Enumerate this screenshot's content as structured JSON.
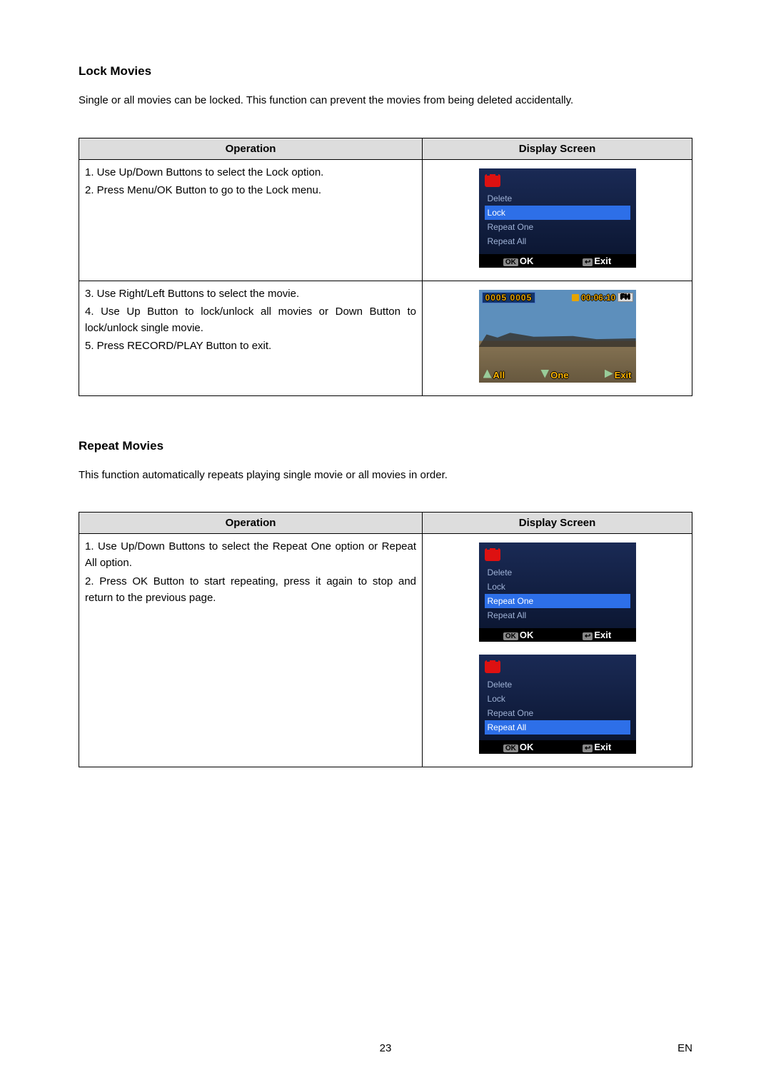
{
  "sections": {
    "lock": {
      "heading": "Lock Movies",
      "lead": "Single or all movies can be locked. This function can prevent the movies from being deleted accidentally.",
      "table": {
        "head_op": "Operation",
        "head_ds": "Display Screen",
        "row1": {
          "steps": [
            "1. Use Up/Down Buttons to select the Lock option.",
            "2. Press Menu/OK Button to go to the Lock menu."
          ],
          "menu": {
            "items": [
              "Delete",
              "Lock",
              "Repeat One",
              "Repeat All"
            ],
            "selected": "Lock",
            "footer_ok": "OK",
            "footer_exit": "Exit",
            "ok_pill": "OK",
            "exit_pill": "↩"
          }
        },
        "row2": {
          "steps": [
            "3. Use Right/Left Buttons to select the movie.",
            "4. Use Up Button to lock/unlock all movies or Down Button to lock/unlock single movie.",
            "5. Press RECORD/PLAY Button to exit."
          ],
          "play": {
            "counter": "0005 0005",
            "time": "00:06:10",
            "badge": "FH",
            "bot_all": "All",
            "bot_one": "One",
            "bot_exit": "Exit"
          }
        }
      }
    },
    "repeat": {
      "heading": "Repeat Movies",
      "lead": "This function automatically repeats playing single movie or all movies in order.",
      "table": {
        "head_op": "Operation",
        "head_ds": "Display Screen",
        "row1": {
          "steps": [
            "1. Use Up/Down Buttons to select the Repeat One option or Repeat All option.",
            "2. Press OK Button to start repeating, press it again to stop and return to the previous page."
          ],
          "menuA": {
            "items": [
              "Delete",
              "Lock",
              "Repeat One",
              "Repeat All"
            ],
            "selected": "Repeat One",
            "footer_ok": "OK",
            "footer_exit": "Exit",
            "ok_pill": "OK",
            "exit_pill": "↩"
          },
          "menuB": {
            "items": [
              "Delete",
              "Lock",
              "Repeat One",
              "Repeat All"
            ],
            "selected": "Repeat All",
            "footer_ok": "OK",
            "footer_exit": "Exit",
            "ok_pill": "OK",
            "exit_pill": "↩"
          }
        }
      }
    }
  },
  "footer": {
    "page_number": "23",
    "lang": "EN"
  }
}
